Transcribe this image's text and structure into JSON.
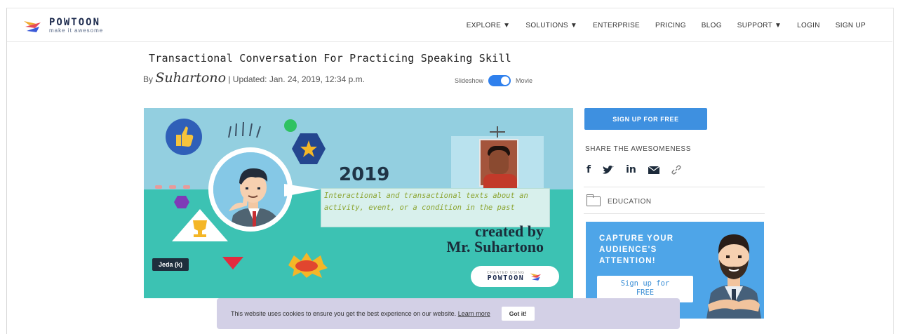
{
  "header": {
    "logo_name": "POWTOON",
    "logo_tagline": "make it awesome",
    "nav": [
      "EXPLORE ▼",
      "SOLUTIONS ▼",
      "ENTERPRISE",
      "PRICING",
      "BLOG",
      "SUPPORT ▼",
      "LOGIN",
      "SIGN UP"
    ]
  },
  "page": {
    "title": "Transactional Conversation For Practicing Speaking Skill",
    "by_prefix": "By",
    "author": "Suhartono",
    "updated": "| Updated: Jan. 24, 2019, 12:34 p.m.",
    "toggle_left": "Slideshow",
    "toggle_right": "Movie"
  },
  "video": {
    "year": "2019",
    "subtitle": "Interactional and transactional texts about an activity, event, or a condition in the past",
    "credit_line1": "created by",
    "credit_line2": "Mr. Suhartono",
    "label": "Jeda (k)",
    "badge_small": "CREATED USING",
    "badge_name": "POWTOON"
  },
  "sidebar": {
    "signup_label": "SIGN UP FOR FREE",
    "share_title": "SHARE THE AWESOMENESS",
    "category": "EDUCATION",
    "ad_text_1": "CAPTURE YOUR",
    "ad_text_2": "AUDIENCE'S",
    "ad_text_3": "ATTENTION!",
    "ad_button_1": "Sign up for",
    "ad_button_2": "FREE"
  },
  "cookie": {
    "message": "This website uses cookies to ensure you get the best experience on our website.",
    "link": "Learn more",
    "button": "Got it!"
  },
  "colors": {
    "accent_blue": "#3e90e0",
    "toggle_blue": "#2f80ed",
    "video_sky": "#93cfe0",
    "video_ground": "#3cc2b3",
    "cookie_bg": "#d3d0e6"
  }
}
